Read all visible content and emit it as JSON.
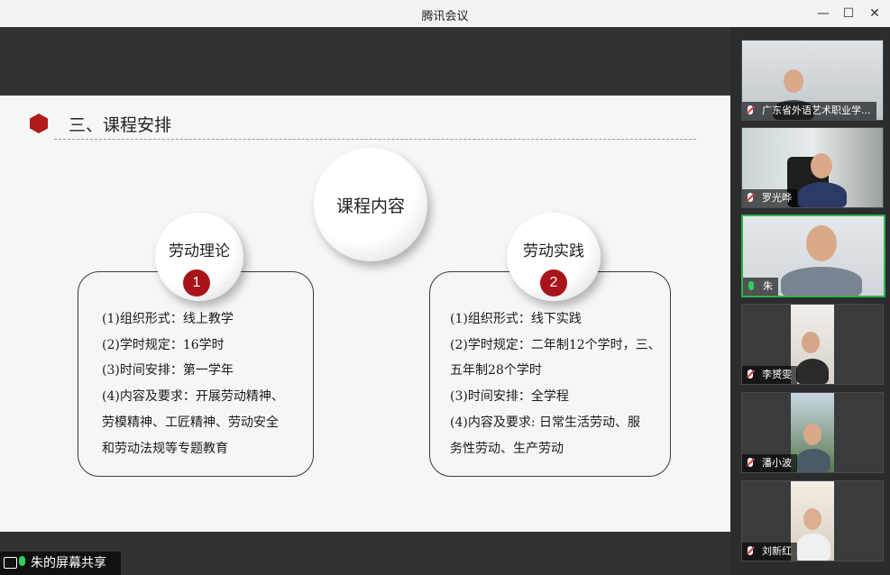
{
  "window": {
    "title": "腾讯会议"
  },
  "slide": {
    "heading": "三、课程安排",
    "center_bubble": "课程内容",
    "left": {
      "bubble": "劳动理论",
      "number": "1",
      "lines": [
        "(1)组织形式：线上教学",
        "(2)学时规定：16学时",
        "(3)时间安排：第一学年",
        "(4)内容及要求：开展劳动精神、",
        "劳模精神、工匠精神、劳动安全",
        "和劳动法规等专题教育"
      ]
    },
    "right": {
      "bubble": "劳动实践",
      "number": "2",
      "lines": [
        "(1)组织形式：线下实践",
        "(2)学时规定：二年制12个学时，三、",
        "五年制28个学时",
        "(3)时间安排：全学程",
        " (4)内容及要求: 日常生活劳动、服",
        "务性劳动、生产劳动"
      ]
    }
  },
  "share": {
    "label": "朱的屏幕共享"
  },
  "participants": [
    {
      "name": "广东省外语艺术职业学...",
      "muted": true
    },
    {
      "name": "罗光晔",
      "muted": true
    },
    {
      "name": "朱",
      "muted": false
    },
    {
      "name": "李赟雯",
      "muted": true
    },
    {
      "name": "潘小波",
      "muted": true
    },
    {
      "name": "刘新红",
      "muted": true
    }
  ],
  "colors": {
    "accent_red": "#a8141a",
    "active_green": "#2db34a"
  }
}
